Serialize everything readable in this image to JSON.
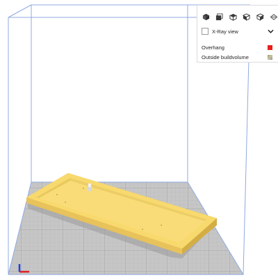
{
  "view_panel": {
    "camera_buttons": [
      {
        "name": "camera-3d-view-button",
        "icon": "cube-3d-icon"
      },
      {
        "name": "camera-front-view-button",
        "icon": "cube-front-icon"
      },
      {
        "name": "camera-top-view-button",
        "icon": "cube-top-icon"
      },
      {
        "name": "camera-left-view-button",
        "icon": "cube-left-icon"
      },
      {
        "name": "camera-right-view-button",
        "icon": "cube-right-icon"
      },
      {
        "name": "view-type-button",
        "icon": "eye-layers-icon"
      }
    ],
    "xray_label": "X-Ray view",
    "xray_checked": false,
    "legend": [
      {
        "label": "Overhang",
        "color": "#e8201c"
      },
      {
        "label": "Outside buildvolume",
        "color": "#b2ad8e"
      }
    ]
  },
  "scene": {
    "model_color": "#f8d96d",
    "model_shade_color": "#e2bf50",
    "build_plate_color": "#c6c6c6",
    "build_volume_outline_color": "#8fa9e3",
    "axis_colors": {
      "x": "#e01f1f",
      "y": "#1f3fe0"
    }
  }
}
